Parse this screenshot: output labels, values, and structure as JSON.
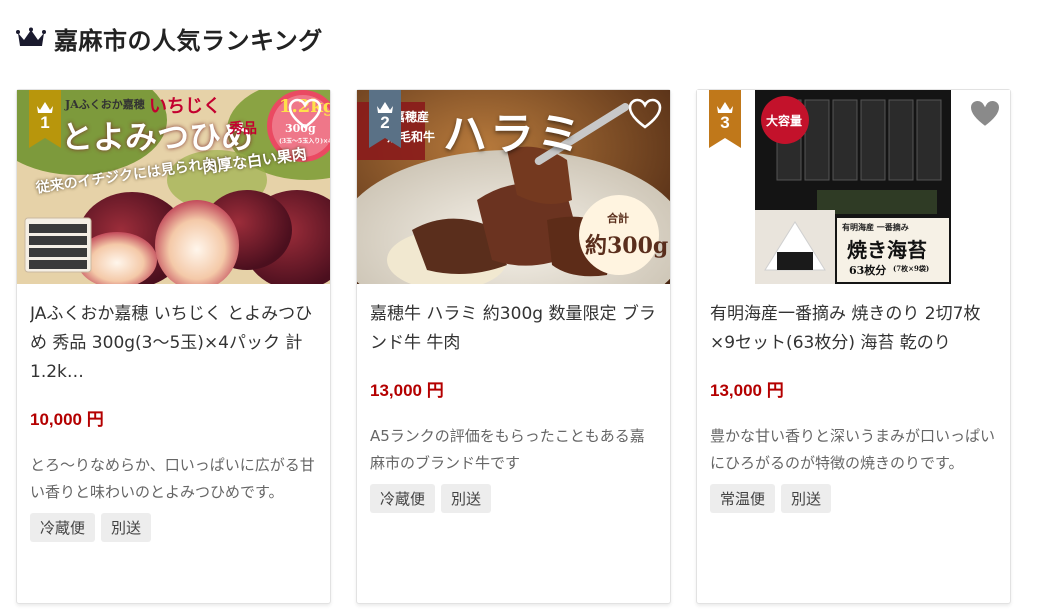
{
  "section": {
    "title": "嘉麻市の人気ランキング",
    "icon": "crown-icon",
    "accent_color": "#1a1a2e"
  },
  "cards": [
    {
      "rank": "1",
      "badge_color": "#b8960c",
      "image_text": {
        "top": "JAふくおか嘉穂",
        "ichijiku": "いちじく",
        "name": "とよみつひめ",
        "grade": "秀品",
        "weight": "1.2kg",
        "weight_sub": "300g",
        "pack": "(3玉～5玉入り)×4パック",
        "line1": "従来のイチジクには見られない",
        "line2": "肉厚な白い果肉"
      },
      "title": "JAふくおか嘉穂 いちじく とよみつひめ 秀品 300g(3～5玉)×4パック 計1.2k…",
      "price": "10,000 円",
      "description": "とろ～りなめらか、口いっぱいに広がる甘い香りと味わいのとよみつひめです。",
      "tags": [
        "冷蔵便",
        "別送"
      ]
    },
    {
      "rank": "2",
      "badge_color": "#5a7186",
      "image_text": {
        "brand1": "嘉穂産",
        "brand2": "黒毛和牛",
        "name": "ハラミ",
        "total": "合計",
        "amount": "約300g"
      },
      "title": "嘉穂牛 ハラミ 約300g 数量限定 ブランド牛 牛肉",
      "price": "13,000 円",
      "description": "A5ランクの評価をもらったこともある嘉麻市のブランド牛です",
      "tags": [
        "冷蔵便",
        "別送"
      ]
    },
    {
      "rank": "3",
      "badge_color": "#c0781a",
      "image_text": {
        "badge": "大容量",
        "origin": "有明海産 一番摘み",
        "name": "焼き海苔",
        "count": "63枚分",
        "count_sub": "(7枚×9袋)"
      },
      "title": "有明海産一番摘み 焼きのり 2切7枚×9セット(63枚分) 海苔 乾のり",
      "price": "13,000 円",
      "description": "豊かな甘い香りと深いうまみが口いっぱいにひろがるのが特徴の焼きのりです。",
      "tags": [
        "常温便",
        "別送"
      ]
    }
  ]
}
